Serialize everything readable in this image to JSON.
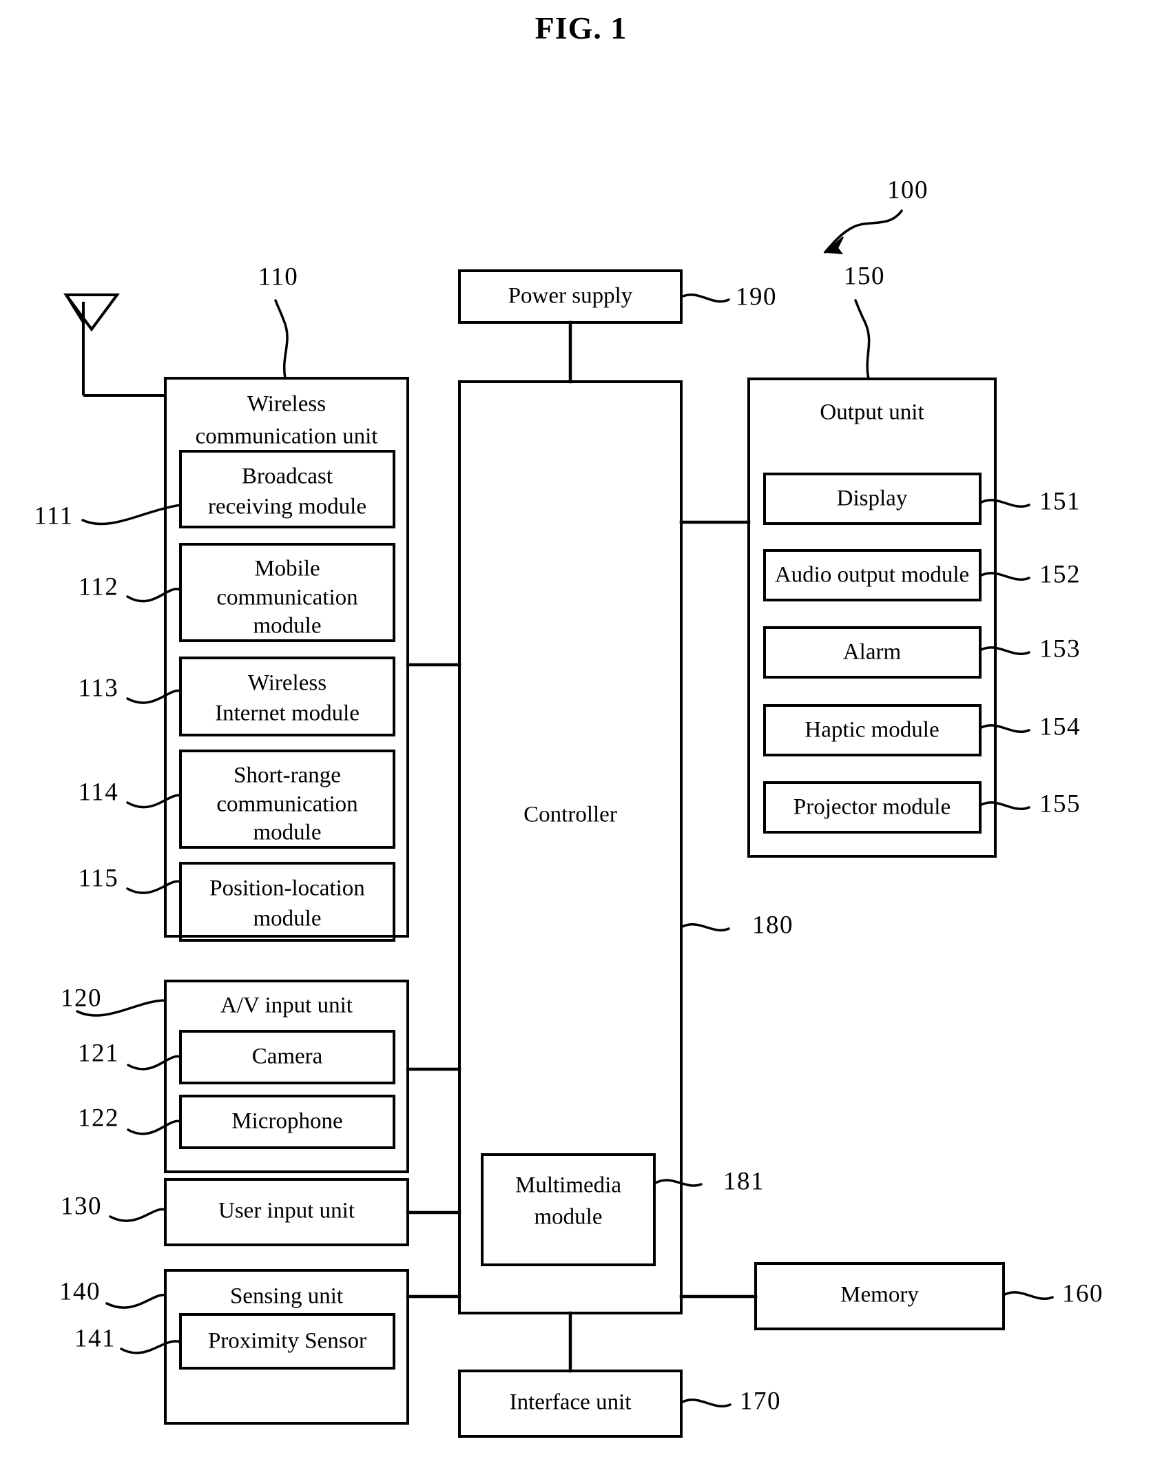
{
  "figure": {
    "title": "FIG. 1",
    "system_ref": "100"
  },
  "blocks": {
    "power_supply": {
      "label": "Power supply",
      "ref": "190"
    },
    "wireless_unit": {
      "label_line1": "Wireless",
      "label_line2": "communication unit",
      "ref": "110",
      "modules": [
        {
          "label_line1": "Broadcast",
          "label_line2": "receiving module",
          "ref": "111"
        },
        {
          "label_line1": "Mobile",
          "label_line2": "communication",
          "label_line3": "module",
          "ref": "112"
        },
        {
          "label_line1": "Wireless",
          "label_line2": "Internet module",
          "ref": "113"
        },
        {
          "label_line1": "Short-range",
          "label_line2": "communication",
          "label_line3": "module",
          "ref": "114"
        },
        {
          "label_line1": "Position-location",
          "label_line2": "module",
          "ref": "115"
        }
      ]
    },
    "av_input_unit": {
      "label": "A/V input unit",
      "ref": "120",
      "modules": [
        {
          "label": "Camera",
          "ref": "121"
        },
        {
          "label": "Microphone",
          "ref": "122"
        }
      ]
    },
    "user_input_unit": {
      "label": "User input unit",
      "ref": "130"
    },
    "sensing_unit": {
      "label": "Sensing unit",
      "ref": "140",
      "modules": [
        {
          "label": "Proximity Sensor",
          "ref": "141"
        }
      ]
    },
    "controller": {
      "label": "Controller",
      "ref": "180",
      "modules": [
        {
          "label_line1": "Multimedia",
          "label_line2": "module",
          "ref": "181"
        }
      ]
    },
    "output_unit": {
      "label": "Output unit",
      "ref": "150",
      "modules": [
        {
          "label": "Display",
          "ref": "151"
        },
        {
          "label": "Audio output module",
          "ref": "152"
        },
        {
          "label": "Alarm",
          "ref": "153"
        },
        {
          "label": "Haptic module",
          "ref": "154"
        },
        {
          "label": "Projector module",
          "ref": "155"
        }
      ]
    },
    "memory": {
      "label": "Memory",
      "ref": "160"
    },
    "interface_unit": {
      "label": "Interface unit",
      "ref": "170"
    }
  },
  "icons": {
    "antenna": "antenna-icon"
  },
  "colors": {
    "stroke": "#000000",
    "background": "#ffffff"
  }
}
